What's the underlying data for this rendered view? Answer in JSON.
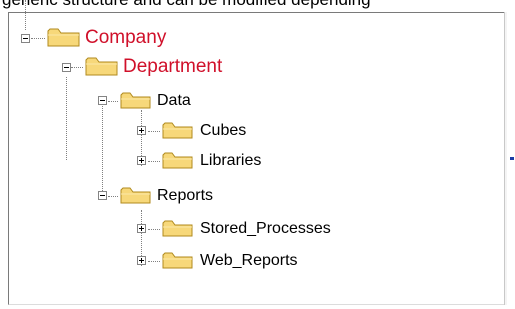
{
  "caption": "generic structure and can be modified depending",
  "tree": {
    "company": {
      "label": "Company",
      "state": "expanded",
      "icon": "folder-icon",
      "color": "#d0102a"
    },
    "department": {
      "label": "Department",
      "state": "expanded",
      "icon": "folder-icon",
      "color": "#d0102a"
    },
    "data": {
      "label": "Data",
      "state": "expanded",
      "icon": "folder-icon"
    },
    "cubes": {
      "label": "Cubes",
      "state": "collapsed",
      "icon": "folder-icon"
    },
    "libraries": {
      "label": "Libraries",
      "state": "collapsed",
      "icon": "folder-icon"
    },
    "reports": {
      "label": "Reports",
      "state": "expanded",
      "icon": "folder-icon"
    },
    "stored_processes": {
      "label": "Stored_Processes",
      "state": "collapsed",
      "icon": "folder-icon"
    },
    "web_reports": {
      "label": "Web_Reports",
      "state": "collapsed",
      "icon": "folder-icon"
    }
  },
  "colors": {
    "folder_fill": "#f7d87a",
    "folder_stroke": "#b08a1e",
    "node_label_red": "#d0102a"
  }
}
